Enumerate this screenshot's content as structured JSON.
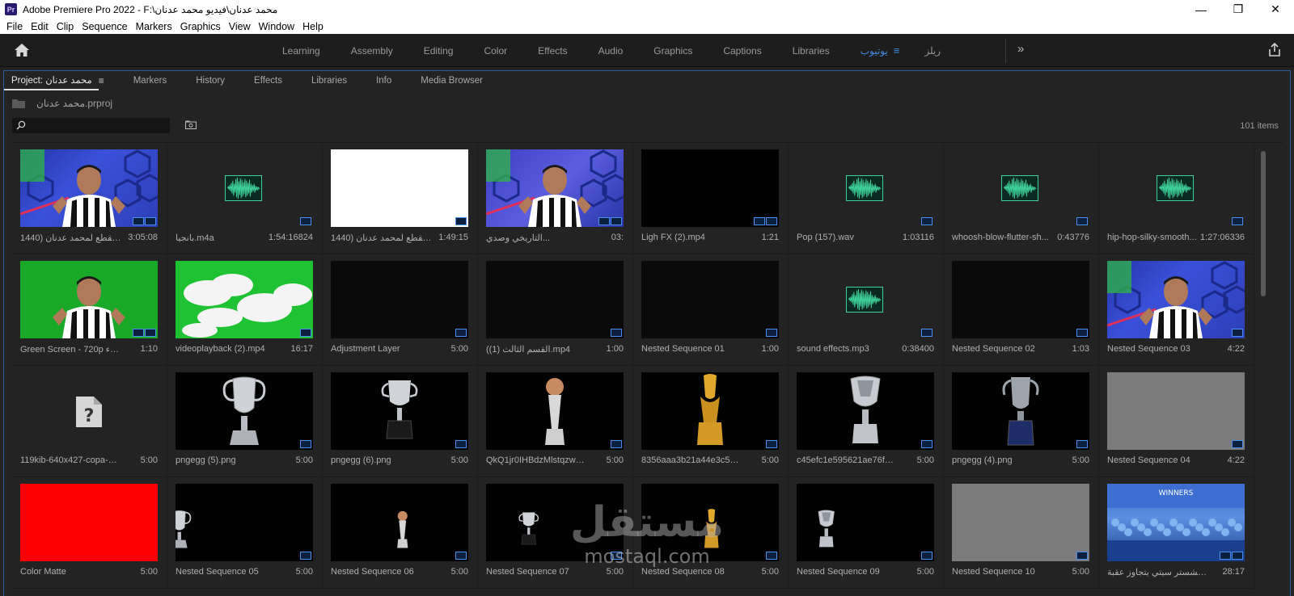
{
  "window": {
    "title": "Adobe Premiere Pro 2022 - F:\\محمد عدنان\\فيديو محمد عدنان",
    "logo_text": "Pr",
    "controls": [
      "—",
      "❐",
      "✕"
    ]
  },
  "menu": [
    "File",
    "Edit",
    "Clip",
    "Sequence",
    "Markers",
    "Graphics",
    "View",
    "Window",
    "Help"
  ],
  "workspaces": {
    "tabs": [
      "Learning",
      "Assembly",
      "Editing",
      "Color",
      "Effects",
      "Audio",
      "Graphics",
      "Captions",
      "Libraries",
      "يوتيوب",
      "ريلز"
    ],
    "active": "يوتيوب",
    "menu_icon": "≡",
    "more_icon": "»",
    "accent_color": "#3d8ee8"
  },
  "panel": {
    "tabs": {
      "project": "Project: محمد عدنان",
      "menu_icon": "≡",
      "others": [
        "Markers",
        "History",
        "Effects",
        "Libraries",
        "Info",
        "Media Browser"
      ]
    },
    "project_file": "محمد عدنان.prproj",
    "search": {
      "value": "",
      "placeholder": ""
    },
    "items_count": "101 items"
  },
  "tiles": [
    {
      "name": "مقطع لمحمد عدنان (1440p",
      "duration": "3:05:08",
      "kind": "video-person",
      "badges": 2
    },
    {
      "name": "بانجيا.m4a",
      "duration": "1:54:16824",
      "kind": "audio",
      "badges": 1
    },
    {
      "name": "مقطع لمحمد عدنان (1440p ...",
      "duration": "1:49:15",
      "kind": "white",
      "badges": 1
    },
    {
      "name": "التاريخي وصدي...",
      "duration": "03:",
      "kind": "video-person-close",
      "badges": 2
    },
    {
      "name": "Ligh FX (2).mp4",
      "duration": "1:21",
      "kind": "black",
      "badges": 2
    },
    {
      "name": "Pop (157).wav",
      "duration": "1:03116",
      "kind": "audio",
      "badges": 1
    },
    {
      "name": "whoosh-blow-flutter-sh...",
      "duration": "0:43776",
      "kind": "audio",
      "badges": 1
    },
    {
      "name": "hip-hop-silky-smooth...",
      "duration": "1:27:06336",
      "kind": "audio",
      "badges": 1
    },
    {
      "name": "Green Screen - 720p السماء",
      "duration": "1:10",
      "kind": "green-person",
      "badges": 2
    },
    {
      "name": "videoplayback (2).mp4",
      "duration": "16:17",
      "kind": "clouds",
      "badges": 1
    },
    {
      "name": "Adjustment Layer",
      "duration": "5:00",
      "kind": "dark",
      "badges": 1
    },
    {
      "name": "(القسم الثالث (1).mp4",
      "duration": "1:00",
      "kind": "dark",
      "badges": 1
    },
    {
      "name": "Nested Sequence 01",
      "duration": "1:00",
      "kind": "dark",
      "badges": 1
    },
    {
      "name": "sound effects.mp3",
      "duration": "0:38400",
      "kind": "audio",
      "badges": 1
    },
    {
      "name": "Nested Sequence 02",
      "duration": "1:03",
      "kind": "dark",
      "badges": 1
    },
    {
      "name": "Nested Sequence 03",
      "duration": "4:22",
      "kind": "video-person",
      "badges": 1
    },
    {
      "name": "119kib-640x427-copa-amer...",
      "duration": "5:00",
      "kind": "missing",
      "badges": 0
    },
    {
      "name": "pngegg (5).png",
      "duration": "5:00",
      "kind": "trophy-ucl",
      "badges": 1
    },
    {
      "name": "pngegg (6).png",
      "duration": "5:00",
      "kind": "trophy-cup",
      "badges": 1
    },
    {
      "name": "QkQ1jr0IHBdzMlstqzwM0...",
      "duration": "5:00",
      "kind": "trophy-ball",
      "badges": 1
    },
    {
      "name": "8356aaa3b21a44e3c5323c0...",
      "duration": "5:00",
      "kind": "trophy-gold",
      "badges": 1
    },
    {
      "name": "c45efc1e595621ae76fb6d1e...",
      "duration": "5:00",
      "kind": "trophy-asia",
      "badges": 1
    },
    {
      "name": "pngegg (4).png",
      "duration": "5:00",
      "kind": "trophy-euro",
      "badges": 1
    },
    {
      "name": "Nested Sequence 04",
      "duration": "4:22",
      "kind": "grey",
      "badges": 1
    },
    {
      "name": "Color Matte",
      "duration": "5:00",
      "kind": "red",
      "badges": 0
    },
    {
      "name": "Nested Sequence 05",
      "duration": "5:00",
      "kind": "seq-ucl",
      "badges": 1
    },
    {
      "name": "Nested Sequence 06",
      "duration": "5:00",
      "kind": "seq-ball",
      "badges": 1
    },
    {
      "name": "Nested Sequence 07",
      "duration": "5:00",
      "kind": "seq-cup",
      "badges": 1
    },
    {
      "name": "Nested Sequence 08",
      "duration": "5:00",
      "kind": "seq-gold",
      "badges": 1
    },
    {
      "name": "Nested Sequence 09",
      "duration": "5:00",
      "kind": "seq-asia",
      "badges": 1
    },
    {
      "name": "Nested Sequence 10",
      "duration": "5:00",
      "kind": "grey",
      "badges": 1
    },
    {
      "name": "مانشستر سيتي يتجاوز عقبة...",
      "duration": "28:17",
      "kind": "stadium",
      "badges": 2
    }
  ],
  "watermark": {
    "arabic": "مستقل",
    "latin": "mostaql.com"
  },
  "colors": {
    "waveform": "#3fd39b",
    "badge_border": "#4a8ff0",
    "panel_focus_border": "#2e5b9a"
  }
}
